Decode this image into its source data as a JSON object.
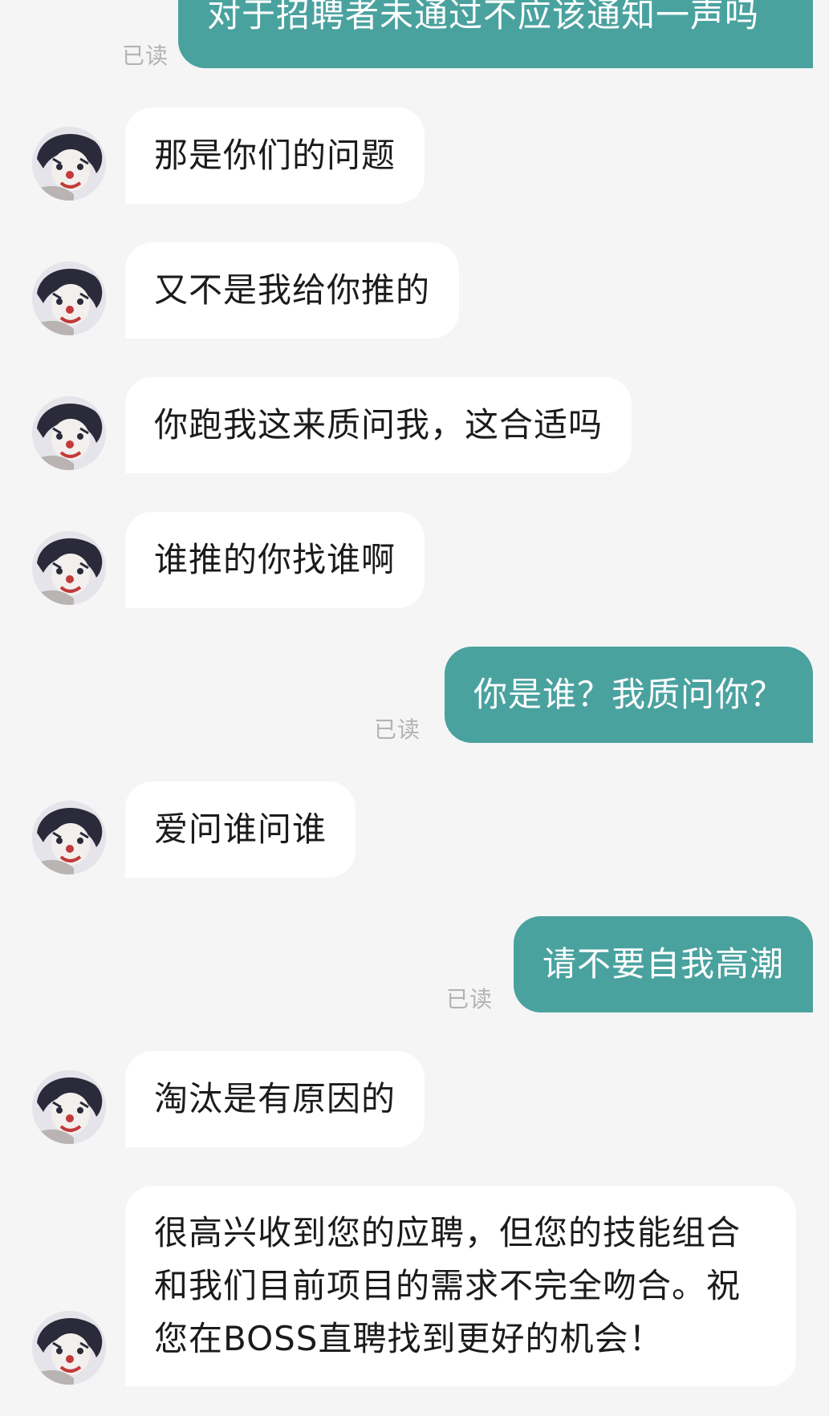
{
  "chat": {
    "colors": {
      "background": "#f5f5f5",
      "outgoing_bubble": "#4aa29f",
      "incoming_bubble": "#ffffff",
      "read_label": "#b3b3b3"
    },
    "read_label": "已读",
    "messages": [
      {
        "from": "me",
        "text": "对于招聘者未通过不应该通知一声吗",
        "status": "已读"
      },
      {
        "from": "recruiter",
        "text": "那是你们的问题"
      },
      {
        "from": "recruiter",
        "text": "又不是我给你推的"
      },
      {
        "from": "recruiter",
        "text": "你跑我这来质问我，这合适吗"
      },
      {
        "from": "recruiter",
        "text": "谁推的你找谁啊"
      },
      {
        "from": "me",
        "text": "你是谁？我质问你？",
        "status": "已读"
      },
      {
        "from": "recruiter",
        "text": "爱问谁问谁"
      },
      {
        "from": "me",
        "text": "请不要自我高潮",
        "status": "已读"
      },
      {
        "from": "recruiter",
        "text": "淘汰是有原因的"
      },
      {
        "from": "recruiter",
        "text": "很高兴收到您的应聘，但您的技能组合和我们目前项目的需求不完全吻合。祝您在BOSS直聘找到更好的机会！"
      }
    ]
  }
}
